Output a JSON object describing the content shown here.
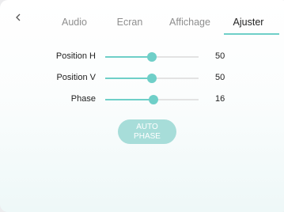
{
  "header": {
    "back_icon": "chevron-left-icon",
    "tabs": [
      {
        "label": "Audio",
        "active": false
      },
      {
        "label": "Ecran",
        "active": false
      },
      {
        "label": "Affichage",
        "active": false
      },
      {
        "label": "Ajuster",
        "active": true
      }
    ]
  },
  "sliders": [
    {
      "label": "Position H",
      "value": "50",
      "fraction": 0.5
    },
    {
      "label": "Position V",
      "value": "50",
      "fraction": 0.5
    },
    {
      "label": "Phase",
      "value": "16",
      "fraction": 0.52
    }
  ],
  "auto_phase": {
    "line1": "AUTO",
    "line2": "PHASE"
  },
  "colors": {
    "accent": "#6fcfc8",
    "button_bg": "#a7ddd9",
    "track": "#e3e3e3"
  }
}
